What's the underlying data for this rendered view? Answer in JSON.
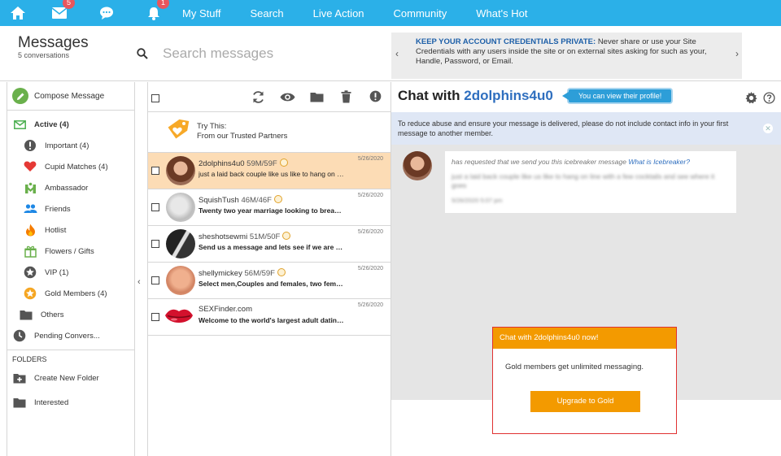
{
  "nav": {
    "badges": {
      "messages": "5",
      "notifications": "1"
    },
    "links": [
      "My Stuff",
      "Search",
      "Live Action",
      "Community",
      "What's Hot"
    ]
  },
  "header": {
    "title": "Messages",
    "subtitle": "5 conversations",
    "search_placeholder": "Search messages",
    "notice_bold": "KEEP YOUR ACCOUNT CREDENTIALS PRIVATE:",
    "notice_text": "Never share or use your Site Credentials with any users inside the site or on external sites asking for such as your, Handle, Password, or Email."
  },
  "sidebar": {
    "compose": "Compose Message",
    "items": [
      {
        "label": "Active (4)",
        "icon": "envelope-icon",
        "level": 0,
        "bold": true
      },
      {
        "label": "Important (4)",
        "icon": "exclamation-icon",
        "level": 1
      },
      {
        "label": "Cupid Matches (4)",
        "icon": "heart-icon",
        "level": 1
      },
      {
        "label": "Ambassador",
        "icon": "ambassador-icon",
        "level": 1
      },
      {
        "label": "Friends",
        "icon": "friends-icon",
        "level": 1
      },
      {
        "label": "Hotlist",
        "icon": "flame-icon",
        "level": 1
      },
      {
        "label": "Flowers / Gifts",
        "icon": "gift-icon",
        "level": 1
      },
      {
        "label": "VIP (1)",
        "icon": "vip-star-icon",
        "level": 1
      },
      {
        "label": "Gold Members (4)",
        "icon": "gold-star-icon",
        "level": 1
      },
      {
        "label": "Others",
        "icon": "folder-icon",
        "level": 0
      },
      {
        "label": "Pending Convers...",
        "icon": "clock-icon",
        "level": 0
      }
    ],
    "folders_heading": "FOLDERS",
    "folders": [
      {
        "label": "Create New Folder",
        "icon": "folder-plus-icon"
      },
      {
        "label": "Interested",
        "icon": "folder-icon"
      }
    ]
  },
  "list": {
    "partner_line1": "Try This:",
    "partner_line2": "From our Trusted Partners",
    "rows": [
      {
        "name": "2dolphins4u0",
        "age": "59M/59F",
        "preview": "just a laid back couple like us like to hang on the ...",
        "date": "5/26/2020",
        "selected": true,
        "avatar": "#b97a5e"
      },
      {
        "name": "SquishTush",
        "age": "46M/46F",
        "preview": "Twenty two year marriage looking to break t...",
        "date": "5/26/2020",
        "selected": false,
        "avatar": "#c9c9c9"
      },
      {
        "name": "sheshotsewmi",
        "age": "51M/50F",
        "preview": "Send us a message and lets see if we are a m...",
        "date": "5/26/2020",
        "selected": false,
        "avatar": "#3a3a3a"
      },
      {
        "name": "shellymickey",
        "age": "56M/59F",
        "preview": "Select men,Couples and females, two female...",
        "date": "5/26/2020",
        "selected": false,
        "avatar": "#d6906c"
      },
      {
        "name": "SEXFinder.com",
        "age": "",
        "preview": "Welcome to the world's largest adult dating s...",
        "date": "5/26/2020",
        "selected": false,
        "avatar": "lips"
      }
    ]
  },
  "chat": {
    "title_prefix": "Chat with",
    "username": "2dolphins4u0",
    "profile_pill": "You can view their profile!",
    "info": "To reduce abuse and ensure your message is delivered, please do not include contact info in your first message to another member.",
    "bubble_lead": "has requested that we send you this icebreaker message",
    "bubble_link": "What is Icebreaker?",
    "bubble_blur": "just a laid back couple like us like to hang on line with a few cocktails and see where it goes",
    "bubble_time": "5/26/2020 5:07 pm",
    "upsell_header": "Chat with 2dolphins4u0 now!",
    "upsell_body": "Gold members get unlimited messaging.",
    "upsell_button": "Upgrade to Gold"
  }
}
